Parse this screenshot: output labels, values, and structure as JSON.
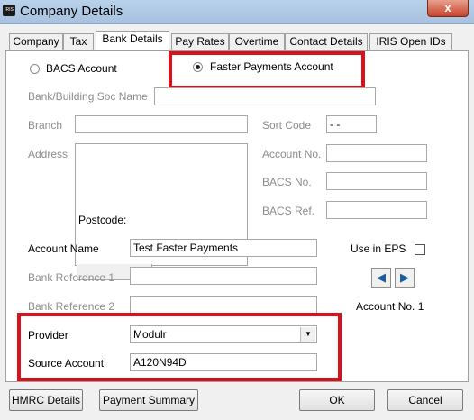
{
  "window": {
    "title": "Company Details",
    "icon_text": "IRIS",
    "close_label": "x"
  },
  "tabs": [
    {
      "label": "Company"
    },
    {
      "label": "Tax"
    },
    {
      "label": "Bank Details"
    },
    {
      "label": "Pay Rates"
    },
    {
      "label": "Overtime"
    },
    {
      "label": "Contact Details"
    },
    {
      "label": "IRIS Open IDs"
    }
  ],
  "bank": {
    "radio_bacs": "BACS Account",
    "radio_faster": "Faster Payments Account",
    "bank_name_label": "Bank/Building Soc Name",
    "bank_name_value": "",
    "branch_label": "Branch",
    "branch_value": "",
    "address_label": "Address",
    "address_value": "",
    "postcode_label": "Postcode:",
    "sort_code_label": "Sort Code",
    "sort_code_value": " - -",
    "account_no_label": "Account No.",
    "account_no_value": "",
    "bacs_no_label": "BACS No.",
    "bacs_no_value": "",
    "bacs_ref_label": "BACS Ref.",
    "bacs_ref_value": "",
    "account_name_label": "Account Name",
    "account_name_value": "Test Faster Payments",
    "bank_ref1_label": "Bank Reference 1",
    "bank_ref1_value": "",
    "bank_ref2_label": "Bank Reference 2",
    "bank_ref2_value": "",
    "use_in_eps_label": "Use in EPS",
    "account_no_indicator": "Account No. 1",
    "provider_label": "Provider",
    "provider_value": "Modulr",
    "source_account_label": "Source Account",
    "source_account_value": "A120N94D"
  },
  "footer": {
    "hmrc_label": "HMRC Details",
    "payment_summary_label": "Payment Summary",
    "ok_label": "OK",
    "cancel_label": "Cancel"
  },
  "colors": {
    "highlight": "#d8121b",
    "title_bar": "#b9d1ea"
  },
  "icons": {
    "prev": "arrow-left-icon",
    "next": "arrow-right-icon",
    "dropdown": "chevron-down-icon"
  }
}
